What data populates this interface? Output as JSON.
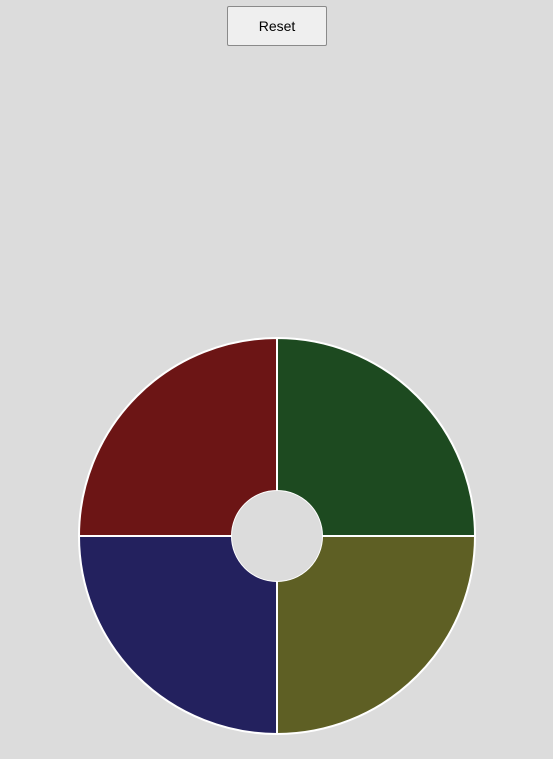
{
  "controls": {
    "reset_label": "Reset"
  },
  "board": {
    "pads": [
      {
        "id": "red",
        "color": "#6c1515",
        "quadrant": "top-left"
      },
      {
        "id": "green",
        "color": "#1d4a20",
        "quadrant": "top-right"
      },
      {
        "id": "blue",
        "color": "#23215e",
        "quadrant": "bottom-left"
      },
      {
        "id": "yellow",
        "color": "#5e5f24",
        "quadrant": "bottom-right"
      }
    ],
    "divider_color": "#ffffff",
    "center_color": "#dcdcdc"
  }
}
